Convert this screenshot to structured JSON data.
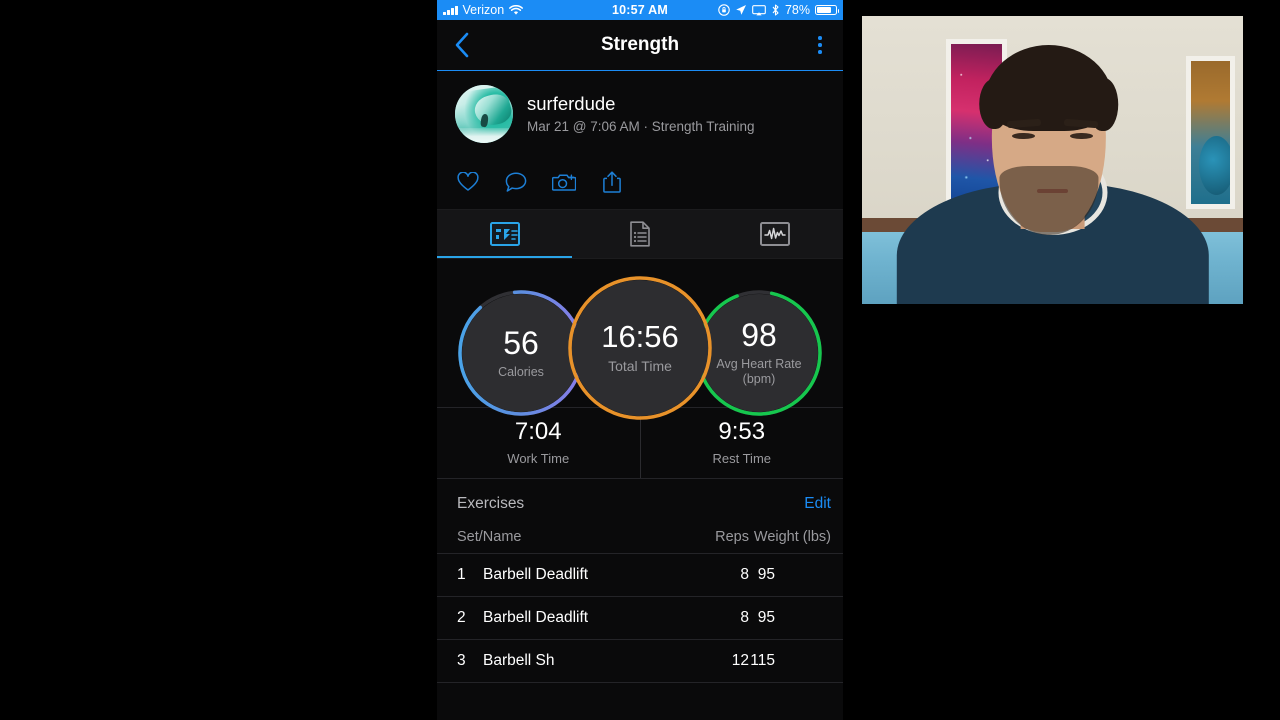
{
  "status_bar": {
    "carrier": "Verizon",
    "wifi_icon": "wifi-icon",
    "signal_icon": "cellular-signal-icon",
    "time": "10:57 AM",
    "rotation_lock_icon": "rotation-lock-icon",
    "location_icon": "location-arrow-icon",
    "airplay_icon": "airplay-icon",
    "bluetooth_icon": "bluetooth-icon",
    "battery_percent": "78%",
    "battery_level": 78
  },
  "nav": {
    "title": "Strength",
    "back_icon": "chevron-left-icon",
    "more_icon": "more-vertical-icon",
    "accent": "#1b8cf5"
  },
  "user": {
    "name": "surferdude",
    "meta": "Mar 21 @ 7:06 AM · Strength Training",
    "avatar_icon": "surf-wave-avatar"
  },
  "actions": [
    {
      "name": "like-button",
      "icon": "heart-icon"
    },
    {
      "name": "comment-button",
      "icon": "comment-bubble-icon"
    },
    {
      "name": "add-photo-button",
      "icon": "camera-plus-icon"
    },
    {
      "name": "share-button",
      "icon": "share-upload-icon"
    }
  ],
  "tabs": [
    {
      "name": "tab-summary",
      "icon": "summary-chart-icon",
      "active": true
    },
    {
      "name": "tab-details",
      "icon": "document-list-icon",
      "active": false
    },
    {
      "name": "tab-heartrate",
      "icon": "heart-rate-graph-icon",
      "active": false
    }
  ],
  "rings": {
    "calories": {
      "value": "56",
      "label": "Calories",
      "color_start": "#4aa3e8",
      "color_end": "#8b7ce8"
    },
    "total_time": {
      "value": "16:56",
      "label": "Total Time",
      "color": "#e8922a"
    },
    "heart_rate": {
      "value": "98",
      "label": "Avg Heart Rate\n(bpm)",
      "label_line1": "Avg Heart Rate",
      "label_line2": "(bpm)",
      "color": "#16c74e"
    }
  },
  "work_rest": [
    {
      "value": "7:04",
      "label": "Work Time"
    },
    {
      "value": "9:53",
      "label": "Rest Time"
    }
  ],
  "exercises": {
    "section_title": "Exercises",
    "edit_label": "Edit",
    "columns": {
      "name": "Set/Name",
      "reps": "Reps",
      "weight": "Weight (lbs)"
    },
    "rows": [
      {
        "set": "1",
        "name": "Barbell Deadlift",
        "reps": "8",
        "weight": "95"
      },
      {
        "set": "2",
        "name": "Barbell Deadlift",
        "reps": "8",
        "weight": "95"
      },
      {
        "set": "3",
        "name": "Barbell Sh",
        "reps": "12",
        "weight": "115"
      }
    ]
  },
  "webcam": {
    "name": "webcam-overlay",
    "description": "presenter-video-feed"
  }
}
